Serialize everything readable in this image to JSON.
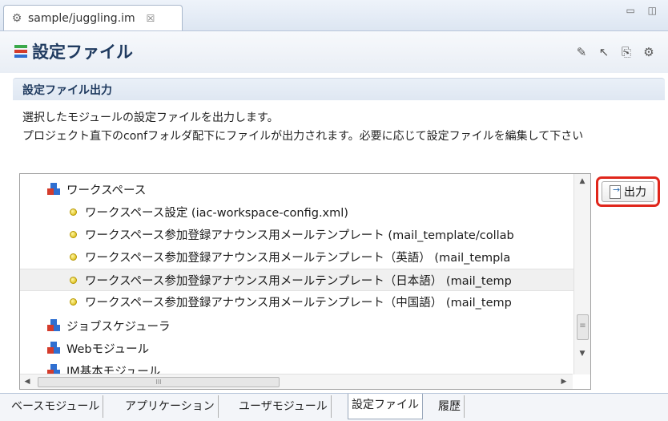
{
  "editor_tab": {
    "title": "sample/juggling.im",
    "close": "☒"
  },
  "window_controls": "▭ ◫",
  "header": {
    "title": "設定ファイル"
  },
  "toolbar_icons": [
    "wand-icon",
    "pin-icon",
    "export-icon",
    "gear-icon"
  ],
  "section": {
    "title": "設定ファイル出力",
    "desc1": "選択したモジュールの設定ファイルを出力します。",
    "desc2": "プロジェクト直下のconfフォルダ配下にファイルが出力されます。必要に応じて設定ファイルを編集して下さい"
  },
  "tree": {
    "rows": [
      {
        "label": "ワークスペース",
        "kind": "module"
      },
      {
        "label": "ワークスペース設定 (iac-workspace-config.xml)",
        "kind": "file"
      },
      {
        "label": "ワークスペース参加登録アナウンス用メールテンプレート (mail_template/collab",
        "kind": "file"
      },
      {
        "label": "ワークスペース参加登録アナウンス用メールテンプレート（英語） (mail_templa",
        "kind": "file"
      },
      {
        "label": "ワークスペース参加登録アナウンス用メールテンプレート（日本語） (mail_temp",
        "kind": "file",
        "selected": true
      },
      {
        "label": "ワークスペース参加登録アナウンス用メールテンプレート（中国語） (mail_temp",
        "kind": "file"
      },
      {
        "label": "ジョブスケジューラ",
        "kind": "module"
      },
      {
        "label": "Webモジュール",
        "kind": "module"
      },
      {
        "label": "IM基本モジュール",
        "kind": "module"
      }
    ]
  },
  "output_button": {
    "label": "出力"
  },
  "bottom_tabs": [
    {
      "label": "ベースモジュール"
    },
    {
      "label": "アプリケーション"
    },
    {
      "label": "ユーザモジュール"
    },
    {
      "label": "設定ファイル",
      "active": true
    },
    {
      "label": "履歴"
    }
  ],
  "colors": {
    "title": "#1f3a5f",
    "highlight_border": "#e0261b",
    "selection_bg": "#f0f0f0"
  }
}
